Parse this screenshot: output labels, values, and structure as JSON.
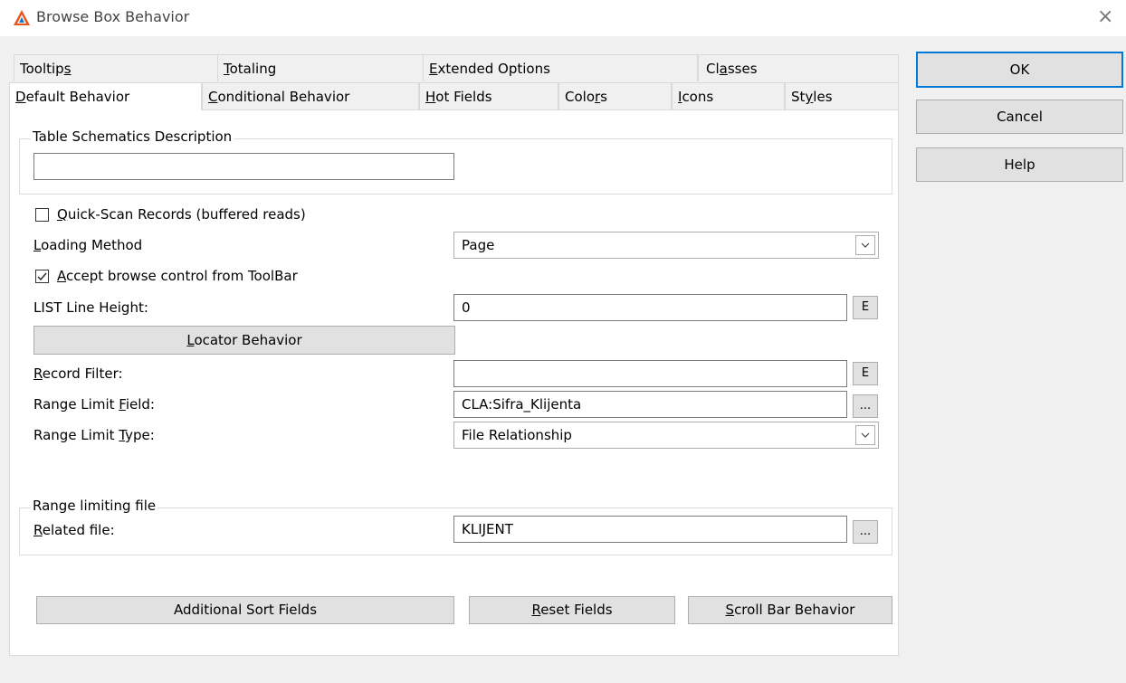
{
  "window": {
    "title": "Browse Box Behavior",
    "close_glyph": "×"
  },
  "tabs_row1": [
    {
      "pre": "Tooltip",
      "ul": "s",
      "post": ""
    },
    {
      "pre": "",
      "ul": "T",
      "post": "otaling"
    },
    {
      "pre": "",
      "ul": "E",
      "post": "xtended Options"
    },
    {
      "pre": "Cl",
      "ul": "a",
      "post": "sses"
    }
  ],
  "tabs_row2": [
    {
      "pre": "",
      "ul": "D",
      "post": "efault Behavior"
    },
    {
      "pre": "",
      "ul": "C",
      "post": "onditional Behavior"
    },
    {
      "pre": "",
      "ul": "H",
      "post": "ot Fields"
    },
    {
      "pre": "Colo",
      "ul": "r",
      "post": "s"
    },
    {
      "pre": "",
      "ul": "I",
      "post": "cons"
    },
    {
      "pre": "St",
      "ul": "y",
      "post": "les"
    }
  ],
  "side_buttons": {
    "ok": "OK",
    "cancel": "Cancel",
    "help": "Help"
  },
  "schematics": {
    "title": "Table Schematics Description",
    "value": ""
  },
  "quick_scan": {
    "pre": "",
    "ul": "Q",
    "post": "uick-Scan Records (buffered reads)",
    "checked": false
  },
  "loading_method": {
    "pre": "",
    "ul": "L",
    "post": "oading Method",
    "value": "Page"
  },
  "accept_toolbar": {
    "pre": "",
    "ul": "A",
    "post": "ccept browse control from ToolBar",
    "checked": true
  },
  "list_line_height": {
    "label": "LIST Line Height:",
    "value": "0",
    "btn": "E"
  },
  "locator_button": {
    "pre": "",
    "ul": "L",
    "post": "ocator Behavior"
  },
  "record_filter": {
    "pre": "",
    "ul": "R",
    "post": "ecord Filter:",
    "value": "",
    "btn": "E"
  },
  "range_limit_field": {
    "pre": "Range Limit ",
    "ul": "F",
    "post": "ield:",
    "value": "CLA:Sifra_Klijenta",
    "btn": "..."
  },
  "range_limit_type": {
    "pre": "Range Limit ",
    "ul": "T",
    "post": "ype:",
    "value": "File Relationship"
  },
  "range_file": {
    "title": "Range limiting file",
    "pre": "",
    "ul": "R",
    "post": "elated file:",
    "value": "KLIJENT",
    "btn": "..."
  },
  "bottom_buttons": {
    "additional": {
      "pre": "Additional Sort Fields",
      "ul": "",
      "post": ""
    },
    "reset": {
      "pre": "",
      "ul": "R",
      "post": "eset Fields"
    },
    "scroll": {
      "pre": "",
      "ul": "S",
      "post": "croll Bar Behavior"
    }
  },
  "colors": {
    "accent": "#0078d7",
    "background": "#f0f0f0",
    "panel": "#ffffff"
  }
}
